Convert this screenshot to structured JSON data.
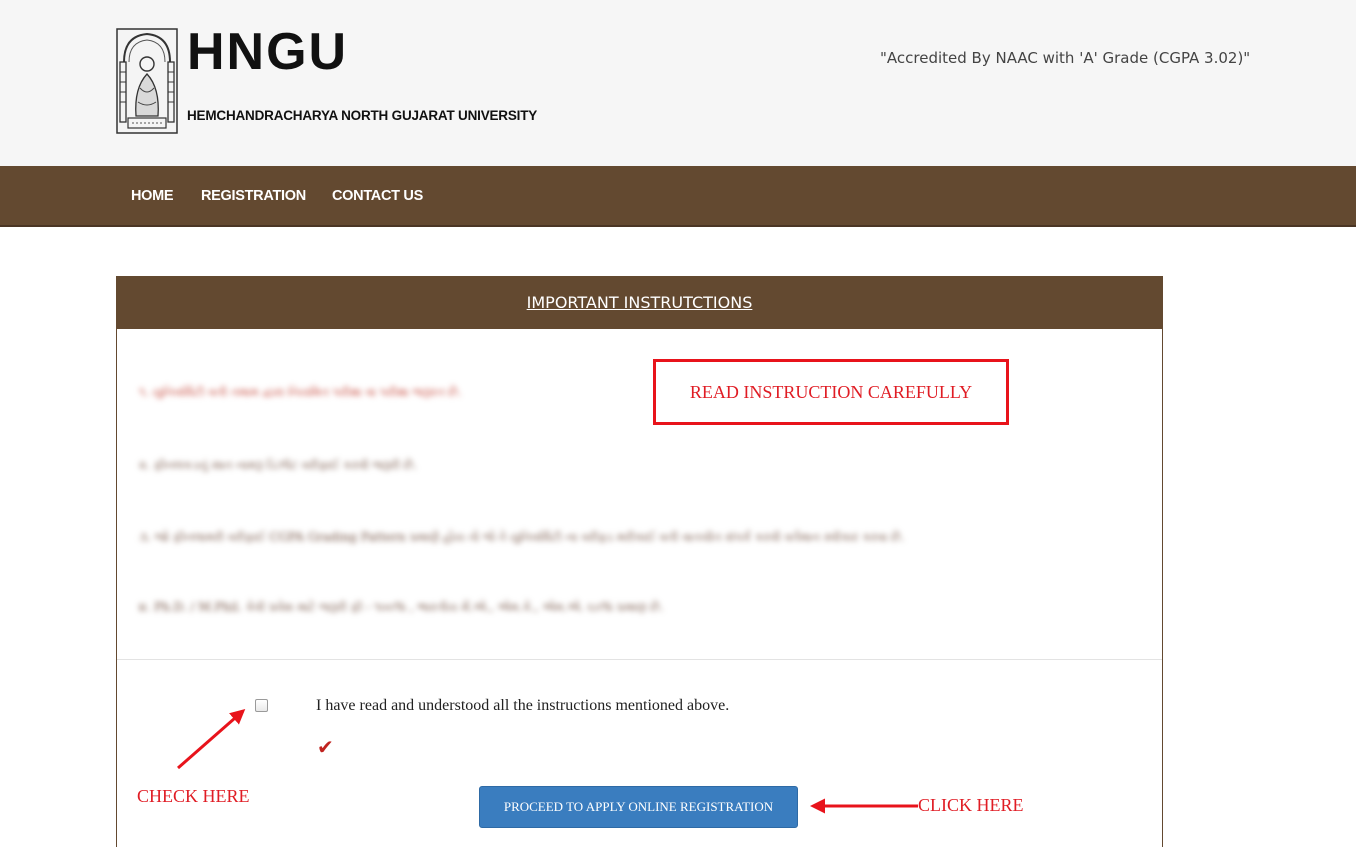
{
  "header": {
    "brand": "HNGU",
    "brand_sub": "HEMCHANDRACHARYA NORTH GUJARAT UNIVERSITY",
    "accreditation": "\"Accredited By NAAC with 'A' Grade (CGPA 3.02)\""
  },
  "nav": {
    "items": [
      {
        "label": "HOME"
      },
      {
        "label": "REGISTRATION"
      },
      {
        "label": "CONTACT US"
      }
    ]
  },
  "panel": {
    "title": "IMPORTANT INSTRUTCTIONS",
    "instructions": [
      "૧. યુનિવર્સિટી વતી તમામ દ્વારા નિયમિત પરીક્ષા વા પરીક્ષા જરૂરત છે.",
      "૨. ફીનલકડનું સાત નામરૂ ડિઝીટ વરીફાઈ કરવી જરૂરી છે.",
      "૩. જો ફીનલામરી વરીફાઈ CGPA Grading Pattern પ્રમાણે હોય તો જે તે યુનિવર્સિટી ના વરીફ્ડ મરીકાઈ વતી વાતચીત સંપર્ક કરવી વર્તમાન સ્વીકાર કરવા છે.",
      "૪. Ph.D. / M.Phil. કેવી પ્રવેશ માટે જરૂરી ફી - ૧૦૦% , ભારતીય મેં.એ., એમ.કે., એમ.એ. ૬૦% પ્રમાણ છે."
    ],
    "warning": "READ INSTRUCTION CAREFULLY",
    "agree_text": "I have read and understood all the instructions mentioned above.",
    "tick_glyph": "✔",
    "proceed_label": "PROCEED TO APPLY ONLINE REGISTRATION"
  },
  "annotations": {
    "check_here": "CHECK HERE",
    "click_here": "CLICK HERE"
  },
  "colors": {
    "brown": "#634930",
    "annotation_red": "#e01c24",
    "button_blue": "#3a7dbf"
  }
}
